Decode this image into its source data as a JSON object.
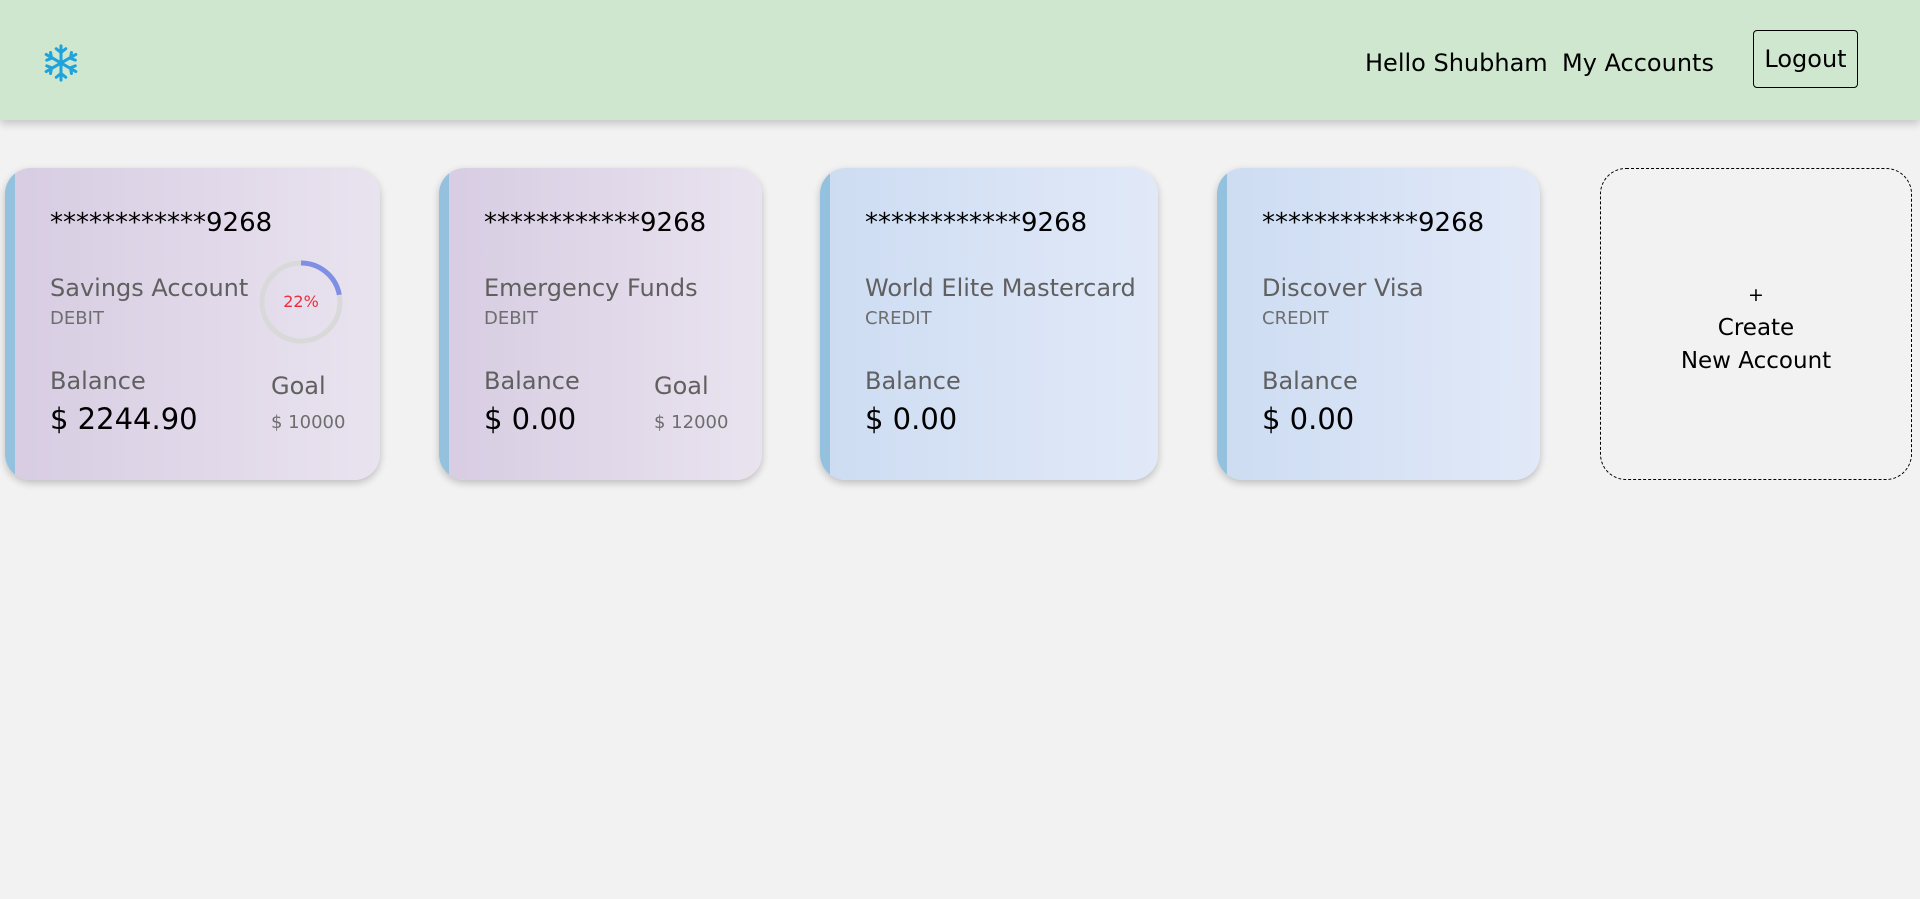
{
  "header": {
    "logo_icon": "snowflake-icon",
    "logo_color": "#1ea3dc",
    "greeting": "Hello Shubham",
    "my_accounts": "My Accounts",
    "logout": "Logout"
  },
  "accounts": [
    {
      "number": "************9268",
      "name": "Savings Account",
      "type": "DEBIT",
      "balance_label": "Balance",
      "balance": "$ 2244.90",
      "goal_label": "Goal",
      "goal": "$ 10000",
      "progress_text": "22%",
      "progress": 0.22
    },
    {
      "number": "************9268",
      "name": "Emergency Funds",
      "type": "DEBIT",
      "balance_label": "Balance",
      "balance": "$ 0.00",
      "goal_label": "Goal",
      "goal": "$ 12000"
    },
    {
      "number": "************9268",
      "name": "World Elite Mastercard",
      "type": "CREDIT",
      "balance_label": "Balance",
      "balance": "$ 0.00"
    },
    {
      "number": "************9268",
      "name": "Discover Visa",
      "type": "CREDIT",
      "balance_label": "Balance",
      "balance": "$ 0.00"
    }
  ],
  "create_account": {
    "plus": "+",
    "line1": "Create",
    "line2": "New Account"
  },
  "colors": {
    "header_bg": "#cfe6cf",
    "progress_track": "#d9d9d9",
    "progress_fill": "#7f8fe6",
    "progress_text": "#ec2d3c",
    "card_stripe": "#93c1de"
  }
}
